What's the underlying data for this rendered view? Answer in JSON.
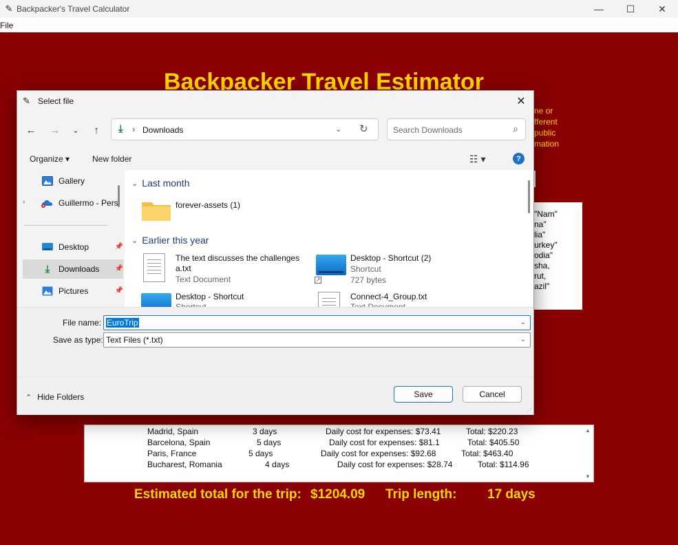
{
  "window": {
    "title": "Backpacker's Travel Calculator",
    "controls": [
      "—",
      "☐",
      "✕"
    ]
  },
  "menu": [
    "File"
  ],
  "app": {
    "header": "Backpacker Travel Estimator",
    "blurb": [
      "ne or",
      "fferent",
      "public",
      "mation"
    ],
    "countries": [
      "\"Nam\"",
      "na\"",
      "lia\"",
      "urkey\"",
      "odia\"",
      "sha,",
      "rut,",
      "azil\""
    ],
    "itinerary": [
      {
        "city": "Madrid, Spain",
        "days": "3 days",
        "daily": "Daily cost for expenses: $73.41",
        "total": "Total: $220.23"
      },
      {
        "city": "Barcelona, Spain",
        "days": "5 days",
        "daily": "Daily cost for expenses: $81.1",
        "total": "Total: $405.50"
      },
      {
        "city": "Paris, France",
        "days": "5 days",
        "daily": "Daily cost for expenses: $92.68",
        "total": "Total: $463.40"
      },
      {
        "city": "Bucharest, Romania",
        "days": "4 days",
        "daily": "Daily cost for expenses: $28.74",
        "total": "Total: $114.96"
      }
    ],
    "summary": {
      "label": "Estimated total for the trip:",
      "amount": "$1204.09",
      "length_label": "Trip length:",
      "length": "17 days"
    }
  },
  "dialog": {
    "title": "Select file",
    "address": {
      "location": "Downloads"
    },
    "search_placeholder": "Search Downloads",
    "toolbar": {
      "organize": "Organize ▾",
      "new_folder": "New folder"
    },
    "nav": [
      {
        "label": "Gallery",
        "icon": "gallery-icon"
      },
      {
        "label": "Guillermo - Pers",
        "icon": "onedrive-icon"
      },
      {
        "label": "Desktop",
        "icon": "desktop-icon"
      },
      {
        "label": "Downloads",
        "icon": "download-icon"
      },
      {
        "label": "Pictures",
        "icon": "pictures-icon"
      }
    ],
    "groups": [
      {
        "label": "Last month"
      },
      {
        "label": "Earlier this year"
      }
    ],
    "files": {
      "forever": {
        "name": "forever-assets (1)"
      },
      "text_doc": {
        "name_line1": "The text discusses the challenges",
        "name_line2": "a.txt",
        "type": "Text Document"
      },
      "desk_shortcut2": {
        "name": "Desktop - Shortcut (2)",
        "type": "Shortcut",
        "size": "727 bytes"
      },
      "desk_shortcut": {
        "name": "Desktop - Shortcut",
        "type": "Shortcut"
      },
      "connect4": {
        "name": "Connect-4_Group.txt",
        "type": "Text Document"
      }
    },
    "file_name_label": "File name:",
    "file_name_value": "EuroTrip",
    "save_type_label": "Save as type:",
    "save_type_value": "Text Files (*.txt)",
    "hide_folders": "Hide Folders",
    "save": "Save",
    "cancel": "Cancel"
  }
}
